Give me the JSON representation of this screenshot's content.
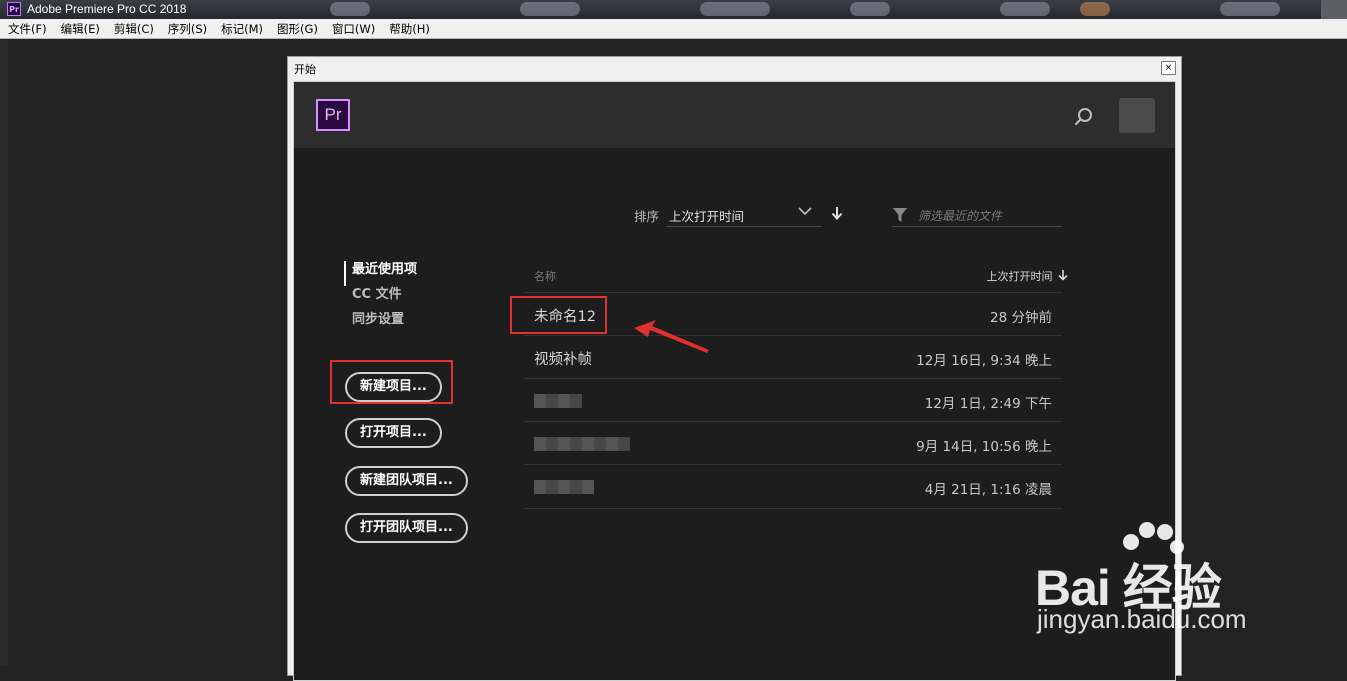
{
  "window": {
    "title": "Adobe Premiere Pro CC 2018",
    "app_icon": "Pr"
  },
  "menubar": {
    "items": [
      "文件(F)",
      "编辑(E)",
      "剪辑(C)",
      "序列(S)",
      "标记(M)",
      "图形(G)",
      "窗口(W)",
      "帮助(H)"
    ]
  },
  "dialog": {
    "title": "开始",
    "close_label": "×",
    "logo": "Pr",
    "sort": {
      "label": "排序",
      "value": "上次打开时间"
    },
    "filter": {
      "placeholder": "筛选最近的文件"
    },
    "nav": [
      "最近使用项",
      "CC 文件",
      "同步设置"
    ],
    "buttons": [
      "新建项目...",
      "打开项目...",
      "新建团队项目...",
      "打开团队项目..."
    ],
    "table": {
      "columns": {
        "name": "名称",
        "date": "上次打开时间"
      },
      "rows": [
        {
          "name": "未命名12",
          "date": "28 分钟前"
        },
        {
          "name": "视频补帧",
          "date": "12月 16日, 9:34 晚上"
        },
        {
          "name": "",
          "date": "12月 1日, 2:49 下午"
        },
        {
          "name": "",
          "date": "9月 14日, 10:56 晚上"
        },
        {
          "name": "",
          "date": "4月 21日, 1:16 凌晨"
        }
      ]
    }
  },
  "watermark": {
    "brand": "Bai 经验",
    "url": "jingyan.baidu.com"
  },
  "colors": {
    "accent": "#d291ff",
    "highlight": "#e03030",
    "background": "#1d1d1d"
  }
}
